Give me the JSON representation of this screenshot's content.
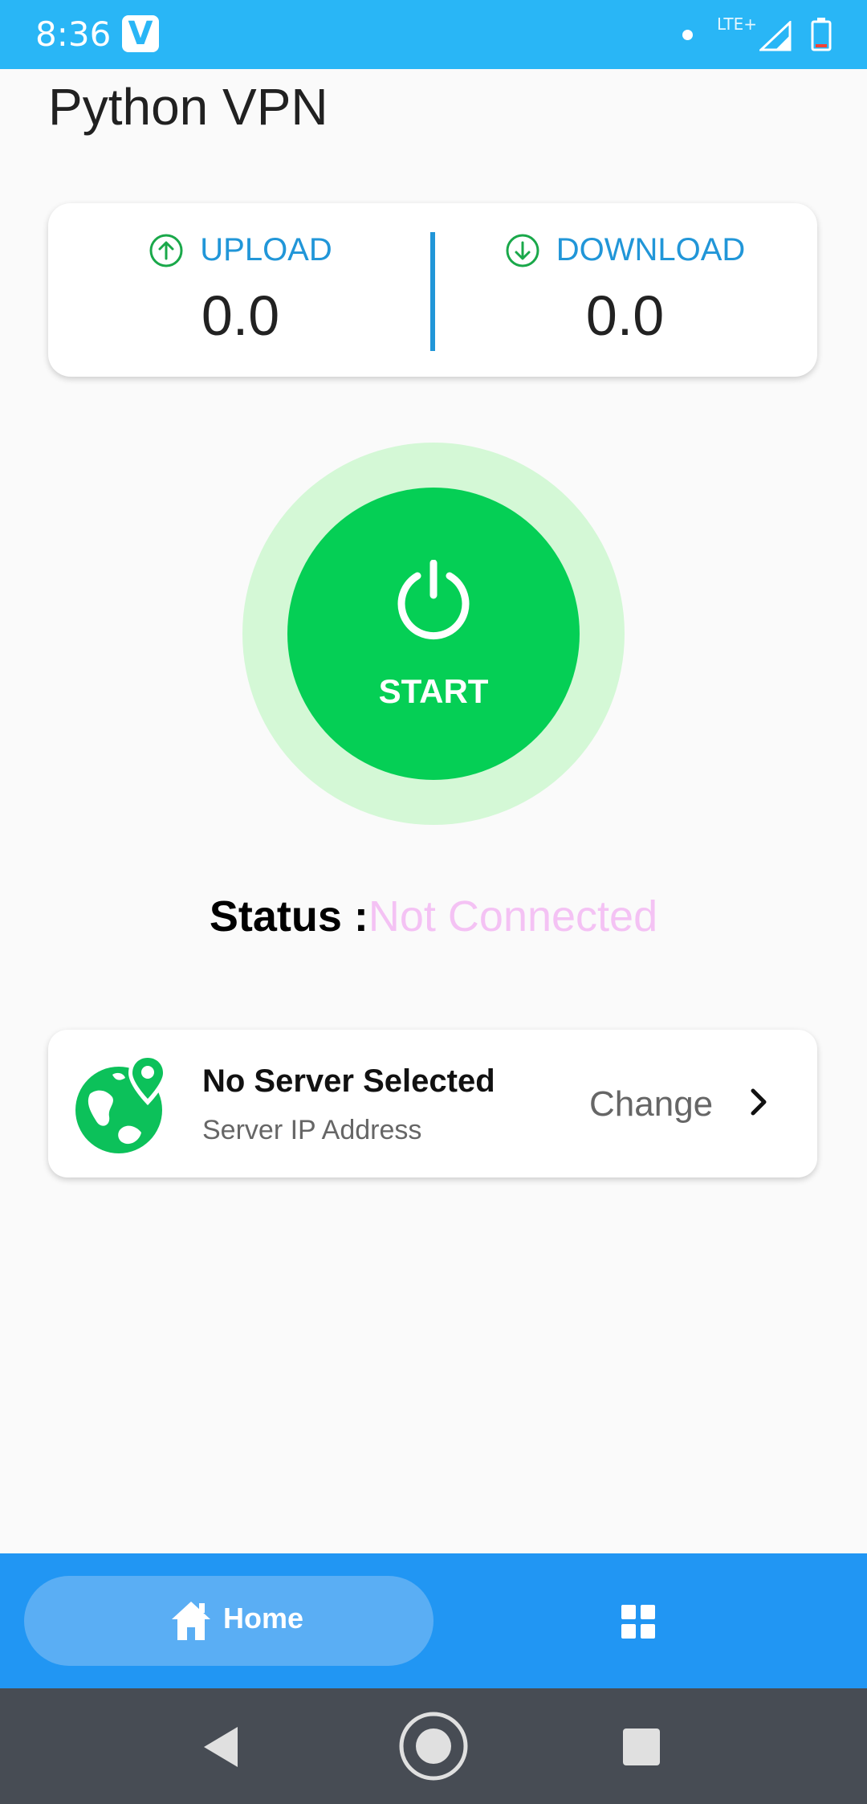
{
  "status_bar": {
    "time": "8:36",
    "app_icon_letter": "V",
    "network_label": "LTE+",
    "icons": [
      "notification-dot-icon",
      "signal-icon",
      "battery-icon"
    ]
  },
  "page": {
    "title": "Python VPN"
  },
  "stats": {
    "upload_label": "UPLOAD",
    "upload_value": "0.0",
    "download_label": "DOWNLOAD",
    "download_value": "0.0",
    "accent_color": "#2196d8",
    "icon_color": "#1aa84a"
  },
  "power": {
    "label": "START",
    "icon": "power-icon",
    "color": "#05cf55",
    "halo_color": "#d4f8d6"
  },
  "status": {
    "key": "Status :",
    "value": "Not Connected",
    "value_color": "#f4c2f4"
  },
  "server": {
    "name": "No Server Selected",
    "ip_label": "Server IP Address",
    "change_label": "Change",
    "icon": "globe-location-icon"
  },
  "bottom_nav": {
    "home_label": "Home",
    "home_icon": "home-icon",
    "second_icon": "grid-icon",
    "color": "#2196f3"
  },
  "system_nav": {
    "icons": [
      "back-icon",
      "home-circle-icon",
      "recent-apps-icon"
    ]
  }
}
